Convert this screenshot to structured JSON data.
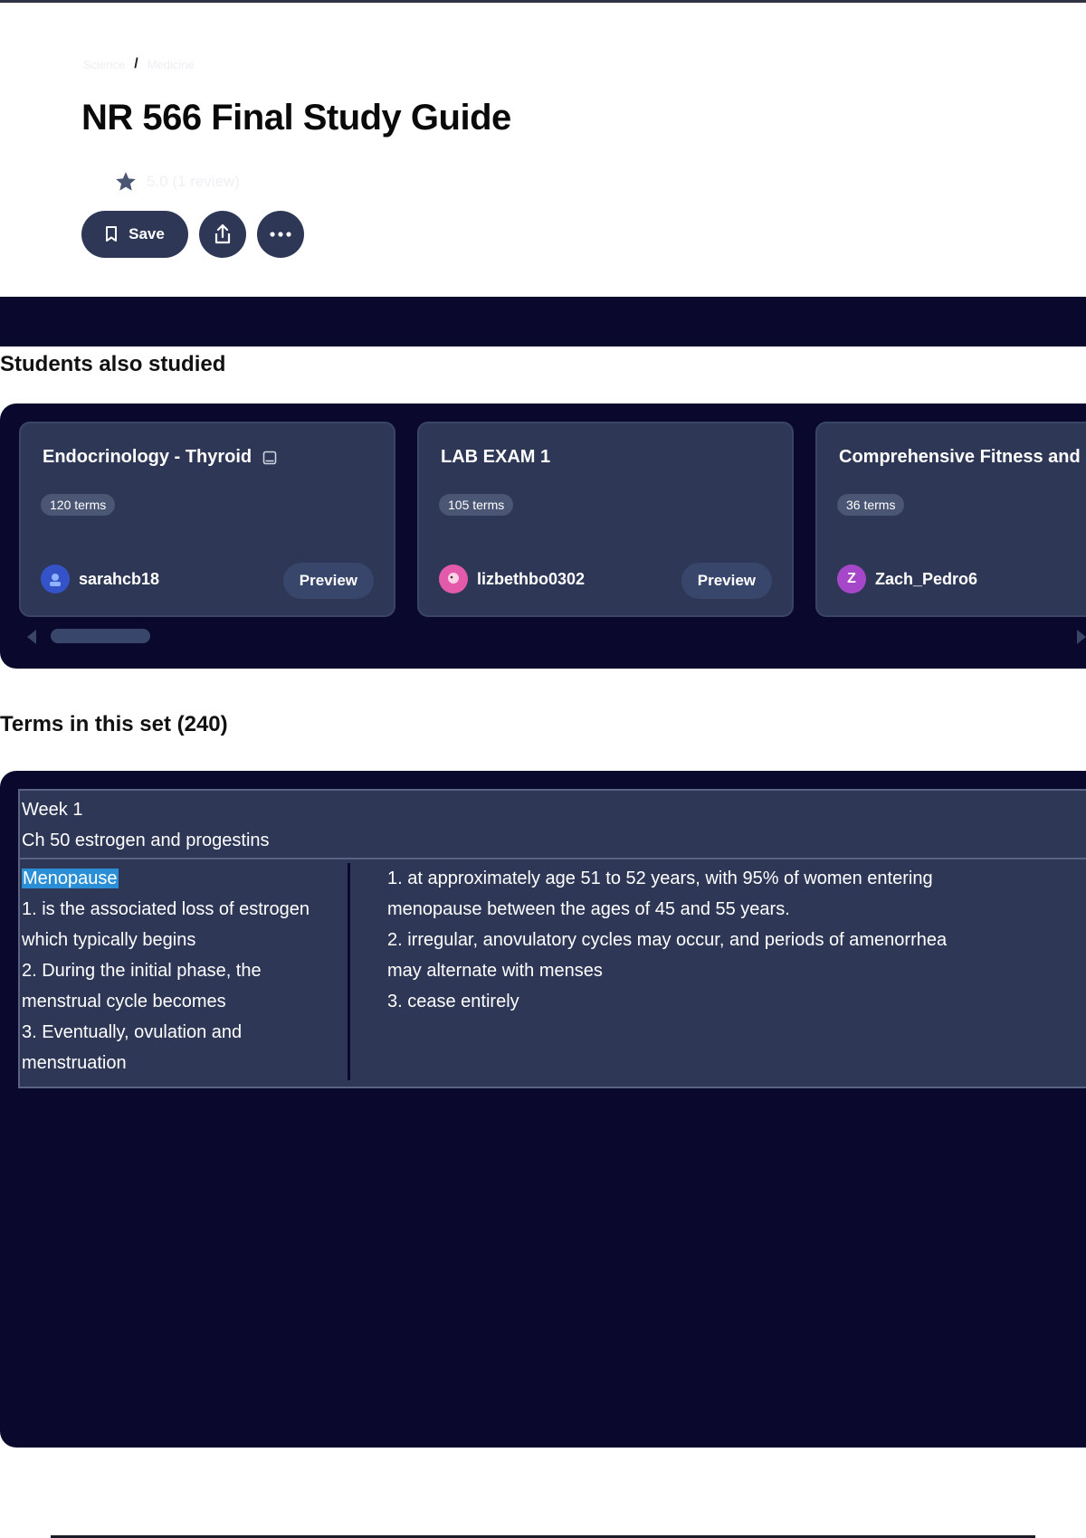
{
  "breadcrumb": {
    "items": [
      "Science",
      "Medicine"
    ],
    "separator": "/"
  },
  "page_title": "NR 566 Final Study Guide",
  "rating": {
    "text": "5.0 (1 review)",
    "star_color": "#4c5673"
  },
  "actions": {
    "save_label": "Save",
    "share_icon": "share-icon",
    "more_icon": "more-icon"
  },
  "students_also_studied": {
    "heading": "Students also studied",
    "cards": [
      {
        "title": "Endocrinology - Thyroid",
        "has_image_icon": true,
        "terms": "120 terms",
        "author": "sarahcb18",
        "avatar_color": "#3553c9",
        "avatar_letter": "",
        "preview_label": "Preview"
      },
      {
        "title": "LAB EXAM 1",
        "has_image_icon": false,
        "terms": "105 terms",
        "author": "lizbethbo0302",
        "avatar_color": "#e25aa9",
        "avatar_letter": "",
        "preview_label": "Preview"
      },
      {
        "title": "Comprehensive Fitness and",
        "has_image_icon": false,
        "terms": "36 terms",
        "author": "Zach_Pedro6",
        "avatar_color": "#a646c9",
        "avatar_letter": "Z",
        "preview_label": "Preview"
      }
    ]
  },
  "terms_set": {
    "heading": "Terms in this set (240)",
    "week_line1": "Week 1",
    "week_line2": "Ch 50 estrogen and progestins",
    "term_highlight": "Menopause",
    "term_lines": [
      "1. is the associated loss of estrogen",
      "which typically begins",
      "2. During the initial phase, the",
      "menstrual cycle becomes",
      "3. Eventually, ovulation and",
      "menstruation"
    ],
    "definition_lines": [
      "1. at approximately age 51 to 52 years, with 95% of women entering",
      "menopause between the ages of 45 and 55 years.",
      "2. irregular, anovulatory cycles may occur, and periods of amenorrhea",
      "may alternate with menses",
      "3. cease entirely"
    ]
  },
  "colors": {
    "dark_navy": "#0a092d",
    "card_bg": "#2e3856",
    "highlight": "#2a8fd6"
  }
}
